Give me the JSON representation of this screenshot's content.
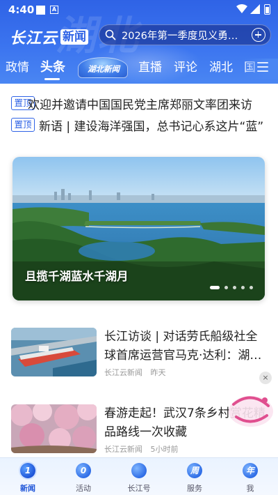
{
  "status_bar": {
    "time": "4:40",
    "a_label": "A"
  },
  "header": {
    "logo_brand": "长江云",
    "logo_news": "新闻",
    "search_placeholder": "2026年第一季度见义勇…",
    "tabs": [
      {
        "label": "政情"
      },
      {
        "label": "头条",
        "active": true
      },
      {
        "label": "湖北新闻",
        "badge": true
      },
      {
        "label": "直播"
      },
      {
        "label": "评论"
      },
      {
        "label": "湖北"
      },
      {
        "label": "国"
      }
    ],
    "accent_color": "#2f63e6"
  },
  "pinned": [
    {
      "tag": "置顶",
      "text": "欢迎并邀请中国国民党主席郑丽文率团来访"
    },
    {
      "tag": "置顶",
      "text": "新语 | 建设海洋强国，总书记心系这片“蓝”"
    }
  ],
  "carousel": {
    "caption": "且揽千湖蓝水千湖月",
    "slide_count": 5,
    "active_index": 0
  },
  "news": [
    {
      "title": "长江访谈 | 对话劳氏船级社全球首席运营官马克·达利：湖…",
      "source": "长江云新闻",
      "time": "昨天"
    },
    {
      "title": "春游走起！武汉7条乡村赏花精品路线一次收藏",
      "source": "长江云新闻",
      "time": "5小时前"
    }
  ],
  "close_label": "×",
  "bottom_nav": [
    {
      "label": "新闻",
      "glyph": "1",
      "active": true
    },
    {
      "label": "活动",
      "glyph": "0"
    },
    {
      "label": "长江号",
      "glyph": ""
    },
    {
      "label": "服务",
      "glyph": "周"
    },
    {
      "label": "我",
      "glyph": "年"
    }
  ]
}
